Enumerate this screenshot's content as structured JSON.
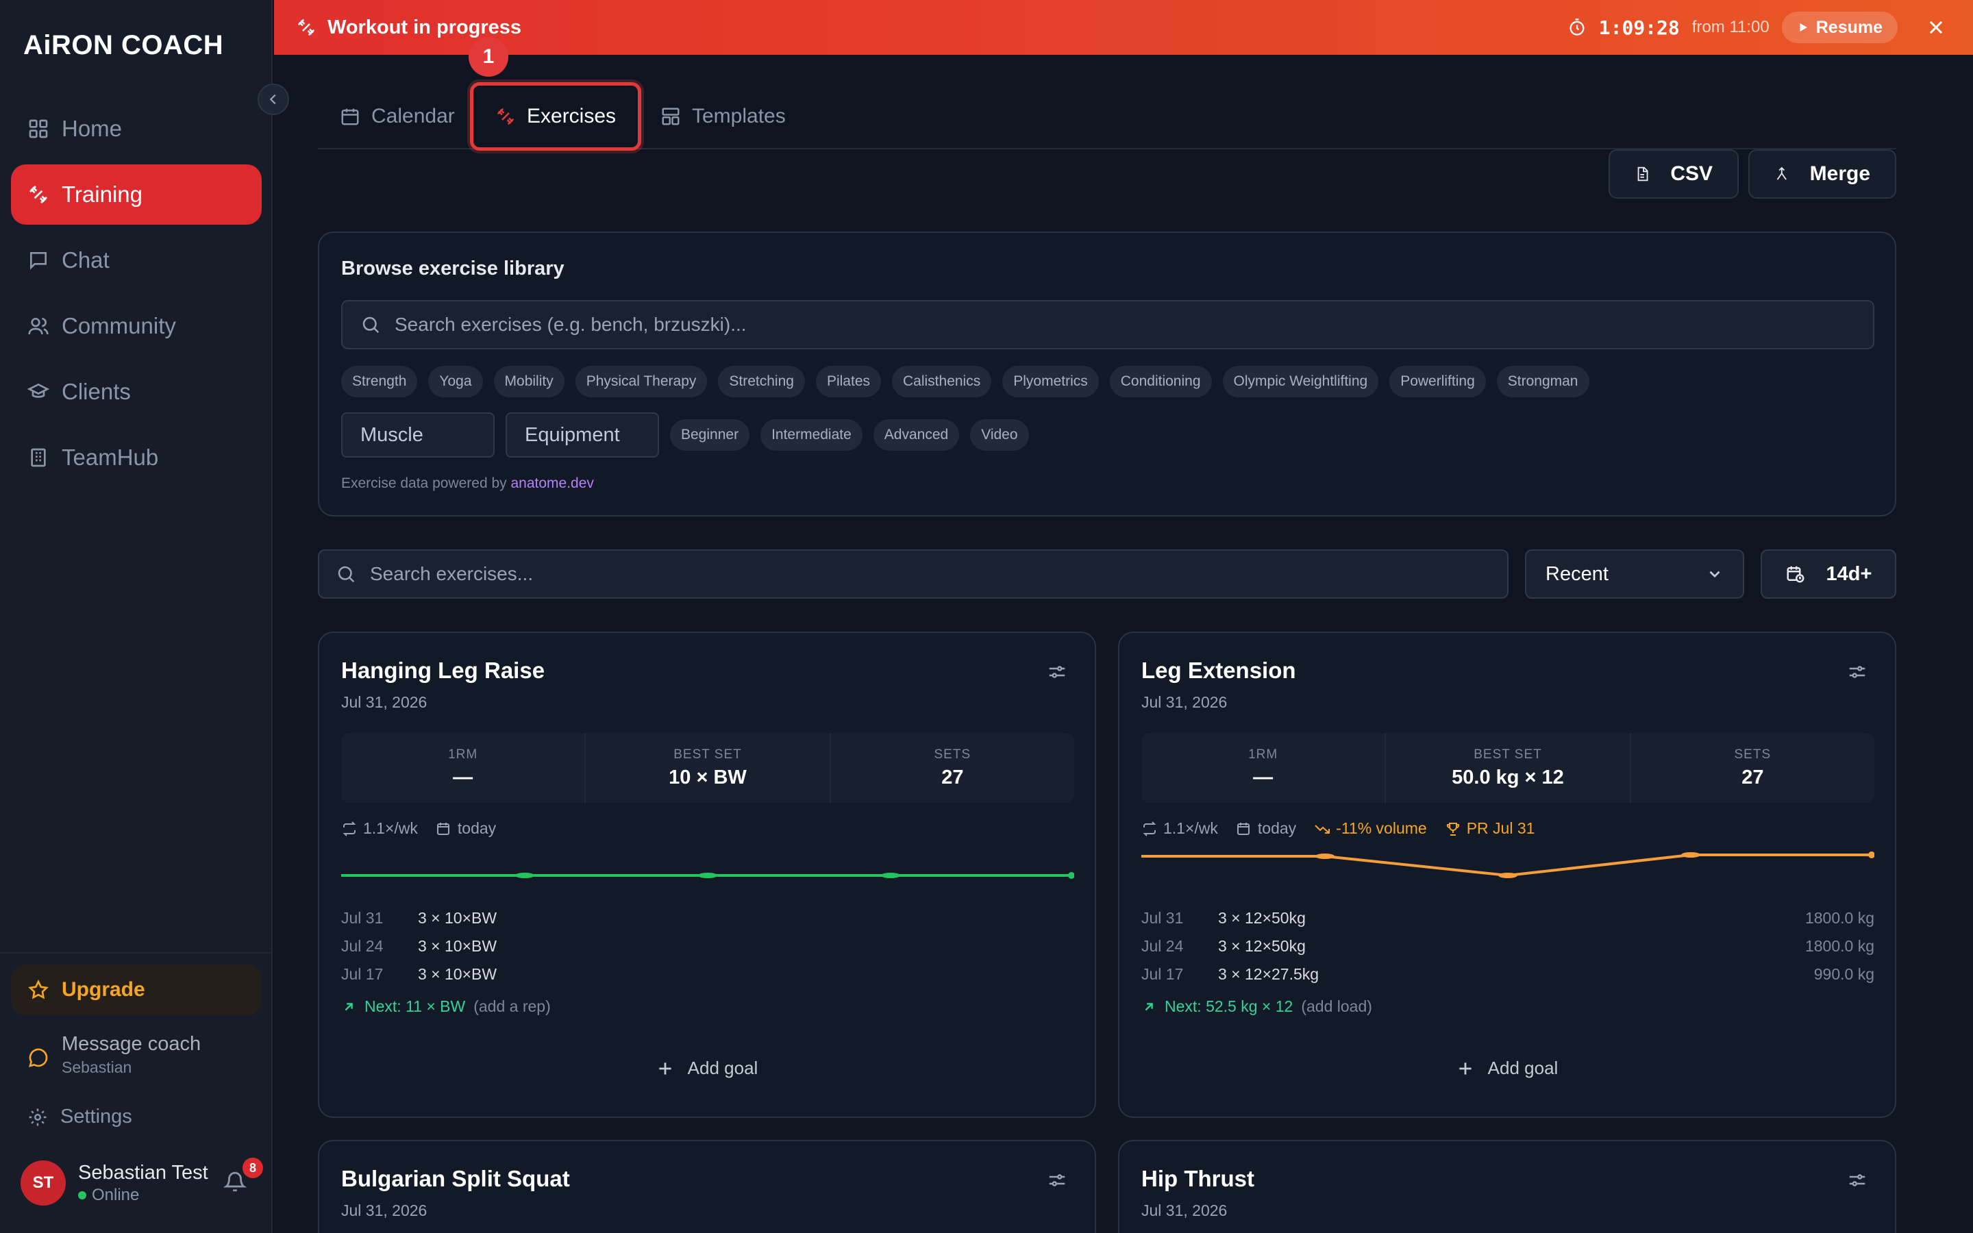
{
  "brand": {
    "logo_text": "AiRON COACH",
    "accent": "#dc2a2f"
  },
  "banner": {
    "title": "Workout in progress",
    "timer": "1:09:28",
    "from": "from 11:00",
    "resume_label": "Resume"
  },
  "sidebar": {
    "items": [
      {
        "label": "Home",
        "icon": "grid-icon"
      },
      {
        "label": "Training",
        "icon": "dumbbell-icon"
      },
      {
        "label": "Chat",
        "icon": "chat-icon"
      },
      {
        "label": "Community",
        "icon": "users-icon"
      },
      {
        "label": "Clients",
        "icon": "graduation-cap-icon"
      },
      {
        "label": "TeamHub",
        "icon": "building-icon"
      }
    ],
    "upgrade_label": "Upgrade",
    "message_coach": {
      "label": "Message coach",
      "coach_name": "Sebastian"
    },
    "settings_label": "Settings",
    "user": {
      "initials": "ST",
      "name": "Sebastian Test",
      "status": "Online",
      "notifications": "8"
    }
  },
  "tabs": [
    {
      "label": "Calendar",
      "icon": "calendar-icon"
    },
    {
      "label": "Exercises",
      "icon": "dumbbell-icon",
      "active": true
    },
    {
      "label": "Templates",
      "icon": "layout-icon"
    }
  ],
  "step_badge": "1",
  "actions": {
    "csv_label": "CSV",
    "merge_label": "Merge"
  },
  "library": {
    "title": "Browse exercise library",
    "search_placeholder": "Search exercises (e.g. bench, brzuszki)...",
    "categories": [
      "Strength",
      "Yoga",
      "Mobility",
      "Physical Therapy",
      "Stretching",
      "Pilates",
      "Calisthenics",
      "Plyometrics",
      "Conditioning",
      "Olympic Weightlifting",
      "Powerlifting",
      "Strongman"
    ],
    "muscle_label": "Muscle",
    "equipment_label": "Equipment",
    "levels": [
      "Beginner",
      "Intermediate",
      "Advanced",
      "Video"
    ],
    "powered_prefix": "Exercise data powered by",
    "powered_link": "anatome.dev"
  },
  "filter": {
    "search_placeholder": "Search exercises...",
    "sort_value": "Recent",
    "period_label": "14d+"
  },
  "cards": [
    {
      "title": "Hanging Leg Raise",
      "date": "Jul 31, 2026",
      "stats": [
        {
          "label": "1RM",
          "value": "—"
        },
        {
          "label": "BEST SET",
          "value": "10 × BW"
        },
        {
          "label": "SETS",
          "value": "27"
        }
      ],
      "frequency": "1.1×/wk",
      "last": "today",
      "history": [
        {
          "date": "Jul 31",
          "sets": "3 × 10×BW",
          "volume": ""
        },
        {
          "date": "Jul 24",
          "sets": "3 × 10×BW",
          "volume": ""
        },
        {
          "date": "Jul 17",
          "sets": "3 × 10×BW",
          "volume": ""
        }
      ],
      "next": "Next: 11 × BW",
      "next_hint": "(add a rep)",
      "add_goal": "Add goal"
    },
    {
      "title": "Leg Extension",
      "date": "Jul 31, 2026",
      "stats": [
        {
          "label": "1RM",
          "value": "—"
        },
        {
          "label": "BEST SET",
          "value": "50.0 kg × 12"
        },
        {
          "label": "SETS",
          "value": "27"
        }
      ],
      "frequency": "1.1×/wk",
      "last": "today",
      "trend": "-11% volume",
      "pr": "PR Jul 31",
      "history": [
        {
          "date": "Jul 31",
          "sets": "3 × 12×50kg",
          "volume": "1800.0 kg"
        },
        {
          "date": "Jul 24",
          "sets": "3 × 12×50kg",
          "volume": "1800.0 kg"
        },
        {
          "date": "Jul 17",
          "sets": "3 × 12×27.5kg",
          "volume": "990.0 kg"
        }
      ],
      "next": "Next: 52.5 kg × 12",
      "next_hint": "(add load)",
      "add_goal": "Add goal"
    },
    {
      "title": "Bulgarian Split Squat",
      "date": "Jul 31, 2026"
    },
    {
      "title": "Hip Thrust",
      "date": "Jul 31, 2026"
    }
  ]
}
